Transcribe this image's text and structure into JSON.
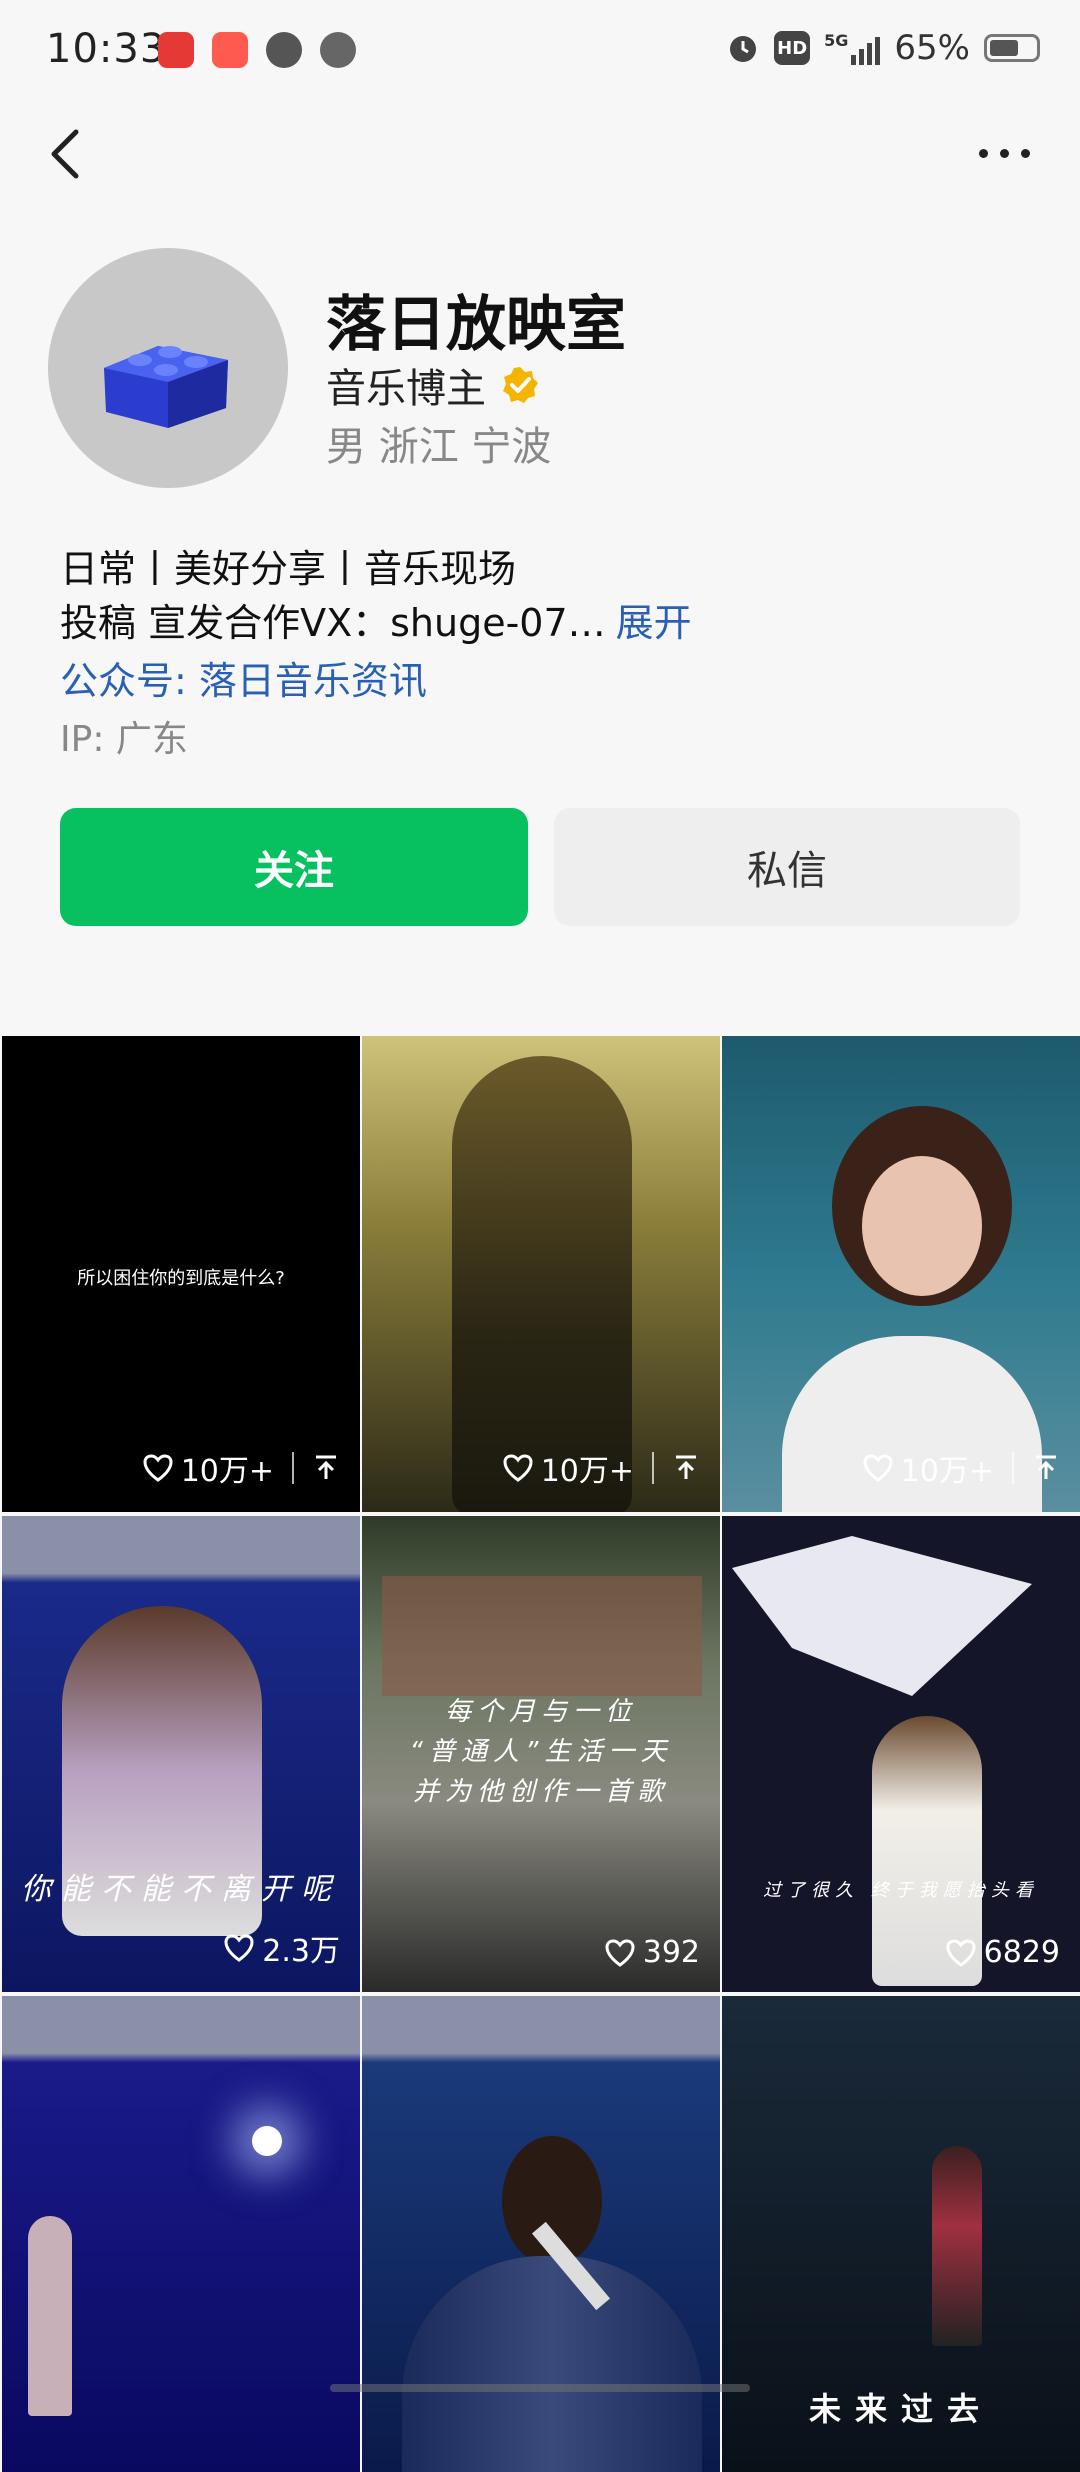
{
  "status_bar": {
    "time": "10:33",
    "battery_text": "65%",
    "hd_badge": "HD",
    "network": "5G",
    "app_icons": [
      "red-app-icon",
      "shopping-app-icon",
      "gauge-app-icon",
      "cat-app-icon"
    ],
    "battery_level": 0.65
  },
  "nav": {
    "back_icon": "chevron-left-icon",
    "more_icon": "more-dots-icon"
  },
  "profile": {
    "name": "落日放映室",
    "role": "音乐博主",
    "meta": "男 浙江 宁波",
    "bio_line1": "日常丨美好分享丨音乐现场",
    "bio_line2": "投稿 宣发合作VX：shuge-07…",
    "expand_label": "展开",
    "official_account": "公众号: 落日音乐资讯",
    "ip": "IP: 广东"
  },
  "actions": {
    "follow_label": "关注",
    "message_label": "私信"
  },
  "colors": {
    "accent_green": "#07c160",
    "link_blue": "#2a5fb6"
  },
  "videos": [
    {
      "caption": "所以困住你的到底是什么?",
      "likes": "10万+",
      "pinned": true
    },
    {
      "caption": "",
      "likes": "10万+",
      "pinned": true
    },
    {
      "caption": "",
      "likes": "10万+",
      "pinned": true
    },
    {
      "caption": "你能不能不离开呢",
      "likes": "2.3万",
      "pinned": false
    },
    {
      "caption": "每个月与一位\n“普通人”生活一天\n并为他创作一首歌",
      "likes": "392",
      "pinned": false
    },
    {
      "caption": "过了很久 终于我愿抬头看",
      "likes": "6829",
      "pinned": false
    },
    {
      "caption": "",
      "likes": "",
      "pinned": false
    },
    {
      "caption": "",
      "likes": "",
      "pinned": false
    },
    {
      "caption": "未来过去",
      "likes": "",
      "pinned": false
    }
  ]
}
